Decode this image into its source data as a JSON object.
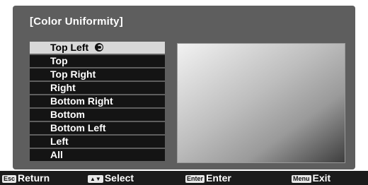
{
  "title": "[Color Uniformity]",
  "menu": {
    "items": [
      {
        "label": "Top Left",
        "selected": true
      },
      {
        "label": "Top"
      },
      {
        "label": "Top Right"
      },
      {
        "label": "Right"
      },
      {
        "label": "Bottom Right"
      },
      {
        "label": "Bottom"
      },
      {
        "label": "Bottom Left"
      },
      {
        "label": "Left"
      },
      {
        "label": "All"
      }
    ],
    "selected_icon": "check-circle-icon"
  },
  "footer": {
    "return": {
      "key": "Esc",
      "label": "Return"
    },
    "select": {
      "key": "▲▼",
      "label": "Select"
    },
    "enter": {
      "key": "Enter",
      "label": "Enter"
    },
    "exit": {
      "key": "Menu",
      "label": "Exit"
    }
  },
  "colors": {
    "panel": "#5e5e5e",
    "item": "#141414",
    "selected_item": "#d8d8d8",
    "footer": "#1b1b1b"
  }
}
